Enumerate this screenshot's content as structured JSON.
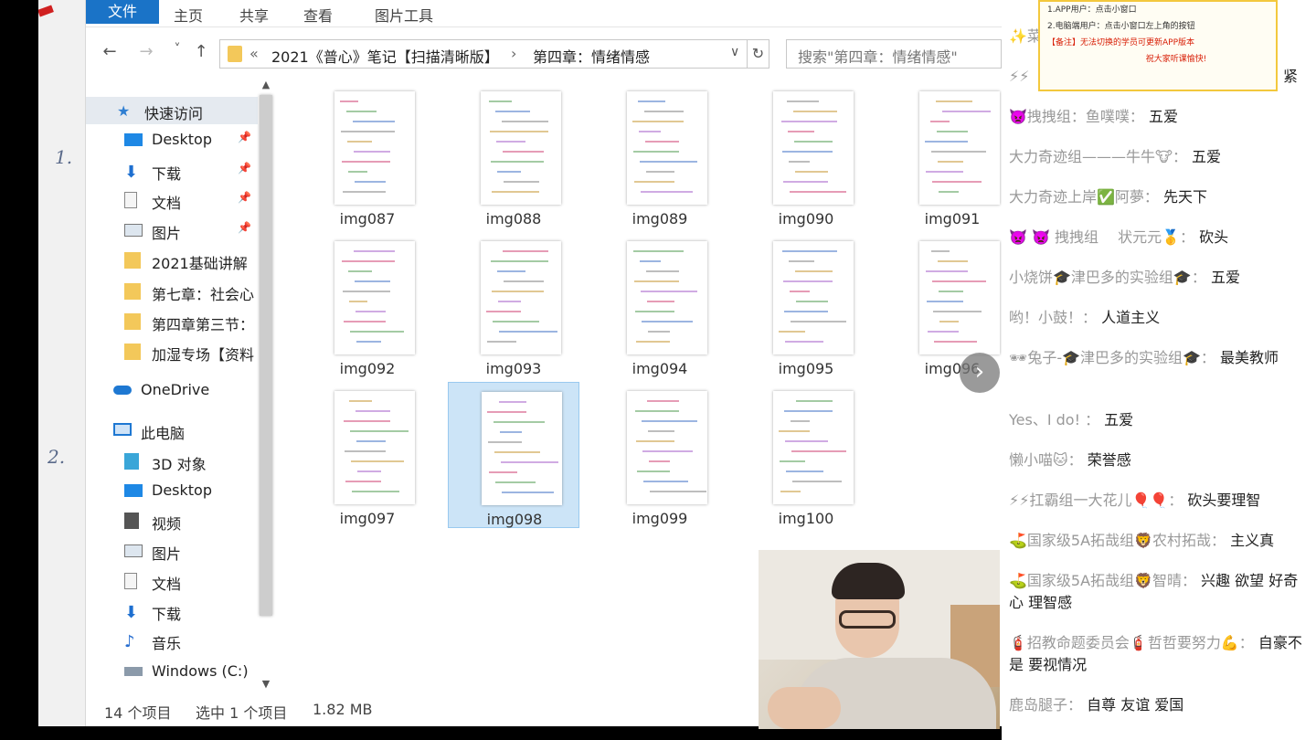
{
  "ribbon": {
    "tabs": [
      "文件",
      "主页",
      "共享",
      "查看",
      "图片工具"
    ]
  },
  "address": {
    "root_chevron": "«",
    "crumbs": [
      "2021《普心》笔记【扫描清晰版】",
      "第四章：情绪情感"
    ],
    "separator": "›",
    "dropdown": "∨",
    "refresh": "↻",
    "search_placeholder": "搜索\"第四章：情绪情感\""
  },
  "nav": {
    "back": "←",
    "forward": "→",
    "recent": "˅",
    "up": "↑",
    "items": [
      {
        "label": "快速访问",
        "icon": "star-icon"
      },
      {
        "label": "Desktop",
        "icon": "desktop-icon",
        "pinned": "📌"
      },
      {
        "label": "下载",
        "icon": "download-icon",
        "pinned": "📌"
      },
      {
        "label": "文档",
        "icon": "document-icon",
        "pinned": "📌"
      },
      {
        "label": "图片",
        "icon": "pictures-icon",
        "pinned": "📌"
      },
      {
        "label": "2021基础讲解",
        "icon": "folder-icon"
      },
      {
        "label": "第七章：社会心",
        "icon": "folder-icon"
      },
      {
        "label": "第四章第三节：",
        "icon": "folder-icon"
      },
      {
        "label": "加湿专场【资料",
        "icon": "folder-icon"
      },
      {
        "label": "OneDrive",
        "icon": "cloud-icon"
      },
      {
        "label": "此电脑",
        "icon": "computer-icon"
      },
      {
        "label": "3D 对象",
        "icon": "cube-icon"
      },
      {
        "label": "Desktop",
        "icon": "desktop-icon"
      },
      {
        "label": "视频",
        "icon": "video-icon"
      },
      {
        "label": "图片",
        "icon": "pictures-icon"
      },
      {
        "label": "文档",
        "icon": "document-icon"
      },
      {
        "label": "下载",
        "icon": "download-icon"
      },
      {
        "label": "音乐",
        "icon": "music-icon"
      },
      {
        "label": "Windows (C:)",
        "icon": "drive-icon"
      }
    ]
  },
  "files": [
    "img087",
    "img088",
    "img089",
    "img090",
    "img091",
    "img092",
    "img093",
    "img094",
    "img095",
    "img096",
    "img097",
    "img098",
    "img099",
    "img100"
  ],
  "selected_file": "img098",
  "status": {
    "count": "14 个项目",
    "selection": "选中 1 个项目",
    "size": "1.82 MB"
  },
  "board": {
    "marks": [
      "1.",
      "2."
    ]
  },
  "notice": {
    "line1": "1.APP用户：点击小窗口",
    "line2": "2.电脑端用户：点击小窗口左上角的按钮",
    "line3": "【备注】无法切换的学员可更新APP版本",
    "line4": "祝大家听课愉快!"
  },
  "chat": [
    {
      "user": "✨菜",
      "text": ""
    },
    {
      "user": "⚡⚡",
      "text": "紧"
    },
    {
      "user": "👿拽拽组：鱼噗噗：",
      "text": "五爱"
    },
    {
      "user": "大力奇迹组———牛牛🐮：",
      "text": "五爱"
    },
    {
      "user": "大力奇迹上岸✅阿夢：",
      "text": "先天下"
    },
    {
      "user": "👿 👿 拽拽组　 状元元🥇：",
      "text": "砍头"
    },
    {
      "user": "小烧饼🎓津巴多的实验组🎓：",
      "text": "五爱"
    },
    {
      "user": "哟！小鼓！：",
      "text": "人道主义"
    },
    {
      "user": "🕶兔子-🎓津巴多的实验组🎓：",
      "text": "最美教师"
    },
    {
      "user": "Yes、I do! ：",
      "text": "五爱"
    },
    {
      "user": "懒小喵🐱：",
      "text": "荣誉感"
    },
    {
      "user": "⚡⚡扛霸组一大花儿🎈🎈：",
      "text": "砍头要理智"
    },
    {
      "user": "⛳国家级5A拓哉组🦁农村拓哉：",
      "text": "主义真"
    },
    {
      "user": "⛳国家级5A拓哉组🦁智晴：",
      "text": "兴趣 欲望 好奇心 理智感"
    },
    {
      "user": "🧯招教命题委员会🧯哲哲要努力💪：",
      "text": "自豪不是 要视情况"
    },
    {
      "user": "鹿岛腿子：",
      "text": "自尊 友谊 爱国"
    }
  ],
  "next_arrow": "›"
}
